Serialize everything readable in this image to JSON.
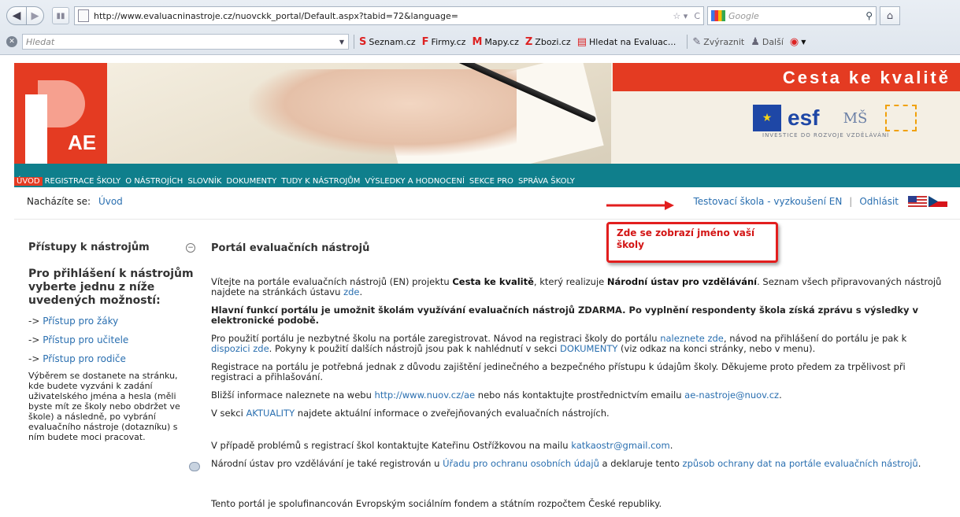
{
  "browser": {
    "url": "http://www.evaluacninastroje.cz/nuovckk_portal/Default.aspx?tabid=72&language=",
    "search_placeholder": "Google",
    "toolbar_search_placeholder": "Hledat",
    "bookmarks": [
      "Seznam.cz",
      "Firmy.cz",
      "Mapy.cz",
      "Zbozi.cz",
      "Hledat na Evaluac...",
      "Zvýraznit",
      "Další"
    ]
  },
  "header": {
    "title": "Cesta ke kvalitě",
    "logo_text": "AE",
    "investment_text": "INVESTICE DO ROZVOJE VZDĚLÁVÁNÍ"
  },
  "menu": {
    "items": [
      "ÚVOD",
      "REGISTRACE ŠKOLY",
      "O NÁSTROJÍCH",
      "SLOVNÍK",
      "DOKUMENTY",
      "TUDY K NÁSTROJŮM",
      "VÝSLEDKY A HODNOCENÍ",
      "SEKCE PRO",
      "SPRÁVA ŠKOLY"
    ]
  },
  "breadcrumb": {
    "label": "Nacházíte se:",
    "current": "Úvod"
  },
  "user": {
    "school": "Testovací škola - vyzkoušení EN",
    "separator": "|",
    "logout": "Odhlásit"
  },
  "callout": {
    "text": "Zde se zobrazí jméno vaší školy"
  },
  "sidebar": {
    "heading": "Přístupy k nástrojům",
    "intro": "Pro přihlášení k nástrojům vyberte jednu z níže uvedených možností:",
    "links": [
      {
        "prefix": "->",
        "label": "Přístup pro žáky"
      },
      {
        "prefix": "->",
        "label": "Přístup pro učitele"
      },
      {
        "prefix": "->",
        "label": "Přístup pro rodiče"
      }
    ],
    "description": "Výběrem se dostanete na stránku, kde budete vyzváni k zadání uživatelského jména a hesla (měli byste mít ze školy nebo obdržet ve škole) a následně, po vybrání evaluačního nástroje (dotazníku) s ním budete moci pracovat."
  },
  "main": {
    "title": "Portál evaluačních nástrojů",
    "p1_a": "Vítejte na portále evaluačních nástrojů (EN) projektu ",
    "p1_b": "Cesta ke kvalitě",
    "p1_c": ", který realizuje ",
    "p1_d": "Národní ústav pro vzdělávání",
    "p1_e": ". Seznam všech připravovaných nástrojů najdete na stránkách ústavu ",
    "p1_link": "zde",
    "p1_f": ".",
    "p2": "Hlavní funkcí portálu je umožnit školám využívání evaluačních nástrojů ZDARMA. Po vyplnění respondenty škola získá zprávu s výsledky v elektronické podobě.",
    "p3_a": "Pro použití portálu je nezbytné školu na portále zaregistrovat. Návod na registraci školy do portálu ",
    "p3_link1": "naleznete zde",
    "p3_b": ", návod na přihlášení do portálu je pak k ",
    "p3_link2": "dispozici zde",
    "p3_c": ". Pokyny k použití dalších nástrojů jsou pak k nahlédnutí v sekci ",
    "p3_link3": "DOKUMENTY",
    "p3_d": " (viz odkaz na konci stránky, nebo v menu).",
    "p4": "Registrace na portálu je potřebná jednak z důvodu zajištění jedinečného a bezpečného přístupu k údajům školy. Děkujeme proto předem za trpělivost při registraci a přihlašování.",
    "p5_a": "Bližší informace naleznete na webu ",
    "p5_link1": "http://www.nuov.cz/ae",
    "p5_b": " nebo nás kontaktujte prostřednictvím emailu ",
    "p5_link2": "ae-nastroje@nuov.cz",
    "p5_c": ".",
    "p6_a": "V sekci ",
    "p6_link": "AKTUALITY",
    "p6_b": " najdete aktuální informace o zveřejňovaných evaluačních nástrojích.",
    "p7_a": "V případě problémů s registrací škol kontaktujte Kateřinu Ostřížkovou na mailu ",
    "p7_link": "katkaostr@gmail.com",
    "p7_b": ".",
    "p8_a": "Národní ústav pro vzdělávání je také registrován u ",
    "p8_link1": "Úřadu pro ochranu osobních údajů",
    "p8_b": " a deklaruje tento ",
    "p8_link2": "způsob ochrany dat na portále evaluačních nástrojů",
    "p8_c": ".",
    "p9": "Tento portál je spolufinancován Evropským sociálním fondem a státním rozpočtem České republiky."
  }
}
